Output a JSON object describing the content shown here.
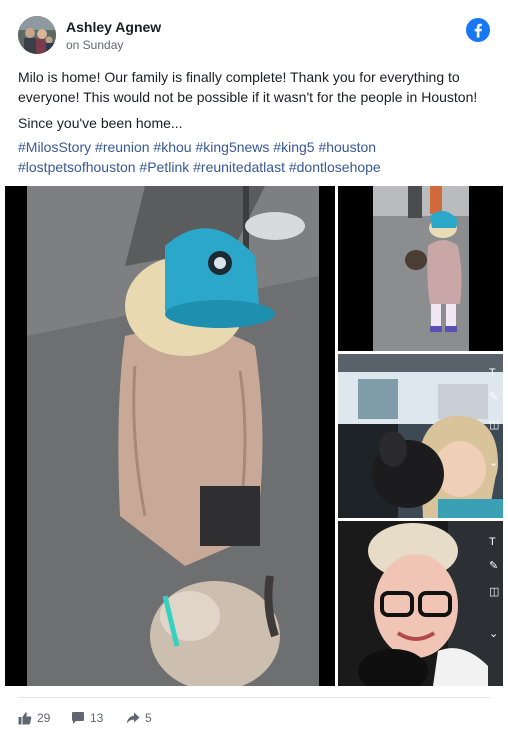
{
  "post": {
    "author": "Ashley Agnew",
    "timestamp": "on Sunday",
    "text_line1": "Milo is home! Our family is finally complete! Thank you for everything to everyone! This would not be possible if it wasn't for the people in Houston!",
    "text_line2": "Since you've been home...",
    "hashtags": [
      "#MilosStory",
      "#reunion",
      "#khou",
      "#king5news",
      "#king5",
      "#houston",
      "#lostpetsofhouston",
      "#Petlink",
      "#reunitedatlast",
      "#dontlosehope"
    ]
  },
  "platform_icon": "facebook-logo-icon",
  "media": {
    "photos": [
      {
        "name": "photo-child-with-dog",
        "icon": "photo"
      },
      {
        "name": "photo-child-walking-dog",
        "icon": "photo"
      },
      {
        "name": "photo-child-hugging-dog-in-car",
        "icon": "photo"
      },
      {
        "name": "photo-woman-selfie-with-dog",
        "icon": "photo"
      }
    ],
    "snap_tools": [
      "T",
      "✎",
      "◫",
      "⌄"
    ]
  },
  "footer": {
    "likes": "29",
    "comments": "13",
    "shares": "5"
  },
  "colors": {
    "brand": "#1877f2",
    "hashtag": "#385898",
    "muted": "#606770"
  }
}
